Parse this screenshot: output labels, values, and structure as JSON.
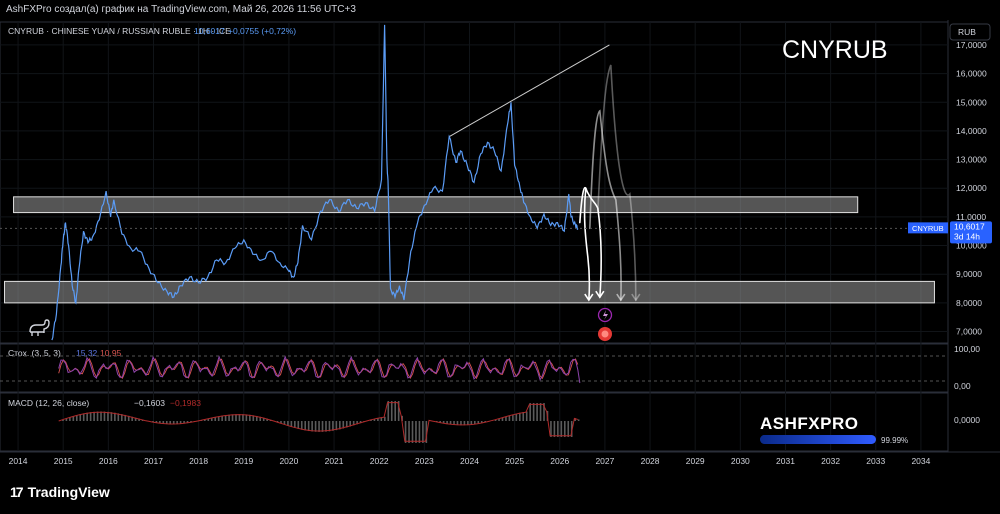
{
  "header": {
    "attribution": "AshFXPro создал(а) график на TradingView.com, Май 26, 2026 11:56 UTC+3"
  },
  "legend": {
    "symbol": "CNYRUB · CHINESE YUAN / RUSSIAN RUBLE · 1H · ICE",
    "price": "10,6017",
    "change": "+0,0755 (+0,72%)"
  },
  "watermark_title": "CNYRUB",
  "currency_button": "RUB",
  "price_tag": {
    "symbol": "CNYRUB",
    "value": "10,6017",
    "countdown": "3d 14h"
  },
  "stoch": {
    "label": "Стох. (3, 5, 3)",
    "k": "15,32",
    "d": "10,95",
    "axis": [
      "100,00",
      "0,00"
    ]
  },
  "macd": {
    "label": "MACD (12, 26, close)",
    "hist": "−0,1603",
    "signal": "−0,1983",
    "axis": [
      "0,0000"
    ]
  },
  "brand": {
    "name": "ASHFXPRO",
    "progress": 0.9999,
    "progress_text": "99.99%"
  },
  "footer": {
    "logo_text": "TradingView"
  },
  "colors": {
    "price_line": "#5b9cf6",
    "stoch_k": "#5b76e0",
    "stoch_d": "#d9534f",
    "macd_line": "#b02a2a",
    "zone_fill": "#9a9a9a"
  },
  "chart_data": {
    "type": "line",
    "title": "CNYRUB",
    "x_ticks": [
      "2014",
      "2015",
      "2016",
      "2017",
      "2018",
      "2019",
      "2020",
      "2021",
      "2022",
      "2023",
      "2024",
      "2025",
      "2026",
      "2027",
      "2028",
      "2029",
      "2030",
      "2031",
      "2032",
      "2033",
      "2034"
    ],
    "y_ticks": [
      "17,0000",
      "16,0000",
      "15,0000",
      "14,0000",
      "13,0000",
      "12,0000",
      "11,0000",
      "10,0000",
      "9,0000",
      "8,0000",
      "7,0000"
    ],
    "ylim": [
      6.6,
      17.8
    ],
    "xlim": [
      2013.6,
      2034.6
    ],
    "series": [
      {
        "name": "CNYRUB",
        "x": [
          2014.75,
          2014.85,
          2014.95,
          2015.0,
          2015.05,
          2015.12,
          2015.2,
          2015.28,
          2015.35,
          2015.45,
          2015.55,
          2015.65,
          2015.8,
          2015.95,
          2016.05,
          2016.12,
          2016.3,
          2016.5,
          2016.7,
          2016.9,
          2017.1,
          2017.3,
          2017.45,
          2017.6,
          2017.8,
          2018.0,
          2018.2,
          2018.4,
          2018.6,
          2018.8,
          2019.0,
          2019.2,
          2019.4,
          2019.6,
          2019.8,
          2020.0,
          2020.1,
          2020.2,
          2020.3,
          2020.5,
          2020.7,
          2020.9,
          2021.1,
          2021.3,
          2021.5,
          2021.7,
          2021.9,
          2022.05,
          2022.12,
          2022.17,
          2022.2,
          2022.25,
          2022.35,
          2022.45,
          2022.55,
          2022.7,
          2022.85,
          2023.0,
          2023.2,
          2023.4,
          2023.55,
          2023.7,
          2023.8,
          2023.95,
          2024.1,
          2024.25,
          2024.4,
          2024.55,
          2024.7,
          2024.85,
          2024.92,
          2025.0,
          2025.1,
          2025.2,
          2025.35,
          2025.5,
          2025.65,
          2025.8,
          2025.95,
          2026.1,
          2026.2,
          2026.25,
          2026.35,
          2026.4
        ],
        "y": [
          6.7,
          7.6,
          9.3,
          10.2,
          10.8,
          10.0,
          8.6,
          8.0,
          9.2,
          10.5,
          10.1,
          10.3,
          10.9,
          11.9,
          11.0,
          11.6,
          10.4,
          9.9,
          9.8,
          9.2,
          8.7,
          8.4,
          8.2,
          8.6,
          8.9,
          8.7,
          8.9,
          9.5,
          9.4,
          9.9,
          10.2,
          9.7,
          9.5,
          9.8,
          9.4,
          9.1,
          8.9,
          9.4,
          10.7,
          10.2,
          11.2,
          11.6,
          11.2,
          11.6,
          11.3,
          11.5,
          11.2,
          12.3,
          17.7,
          13.0,
          12.0,
          8.5,
          8.2,
          8.6,
          8.1,
          9.8,
          10.8,
          11.4,
          12.0,
          11.9,
          13.8,
          12.9,
          13.3,
          12.8,
          12.2,
          13.2,
          13.6,
          13.3,
          12.6,
          14.3,
          15.0,
          12.8,
          12.2,
          11.5,
          11.0,
          10.6,
          11.1,
          10.7,
          10.8,
          10.5,
          11.8,
          11.0,
          10.7,
          10.6
        ]
      }
    ],
    "zones": [
      {
        "name": "upper-zone",
        "x": [
          2013.9,
          2032.6
        ],
        "y": [
          11.15,
          11.7
        ]
      },
      {
        "name": "lower-zone",
        "x": [
          2013.7,
          2034.3
        ],
        "y": [
          8.0,
          8.75
        ]
      }
    ],
    "trendline": {
      "x": [
        2023.55,
        2027.1
      ],
      "y": [
        13.8,
        17.0
      ]
    },
    "legend": "none",
    "grid": true,
    "log_scale": false
  }
}
